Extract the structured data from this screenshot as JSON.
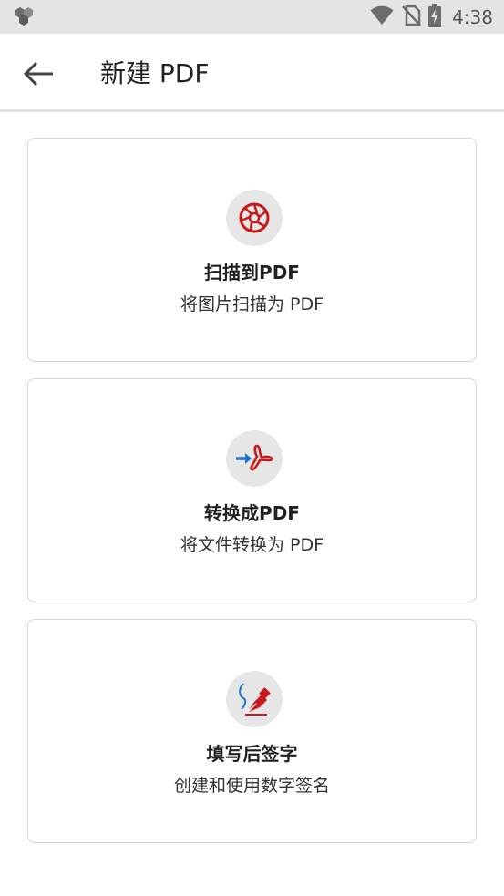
{
  "status_bar": {
    "time": "4:38",
    "icons": [
      "app-notification-icon",
      "wifi-icon",
      "no-sim-icon",
      "battery-charging-icon"
    ]
  },
  "app_bar": {
    "back_icon": "arrow-back-icon",
    "title": "新建 PDF"
  },
  "options": [
    {
      "title": "扫描到PDF",
      "subtitle": "将图片扫描为 PDF",
      "icon": "camera-aperture-icon"
    },
    {
      "title": "转换成PDF",
      "subtitle": "将文件转换为 PDF",
      "icon": "convert-to-pdf-icon"
    },
    {
      "title": "填写后签字",
      "subtitle": "创建和使用数字签名",
      "icon": "pen-signature-icon"
    }
  ],
  "colors": {
    "accent_red": "#c8191c",
    "accent_blue": "#1e73d2",
    "status_bar_bg": "#e4e4e4"
  }
}
